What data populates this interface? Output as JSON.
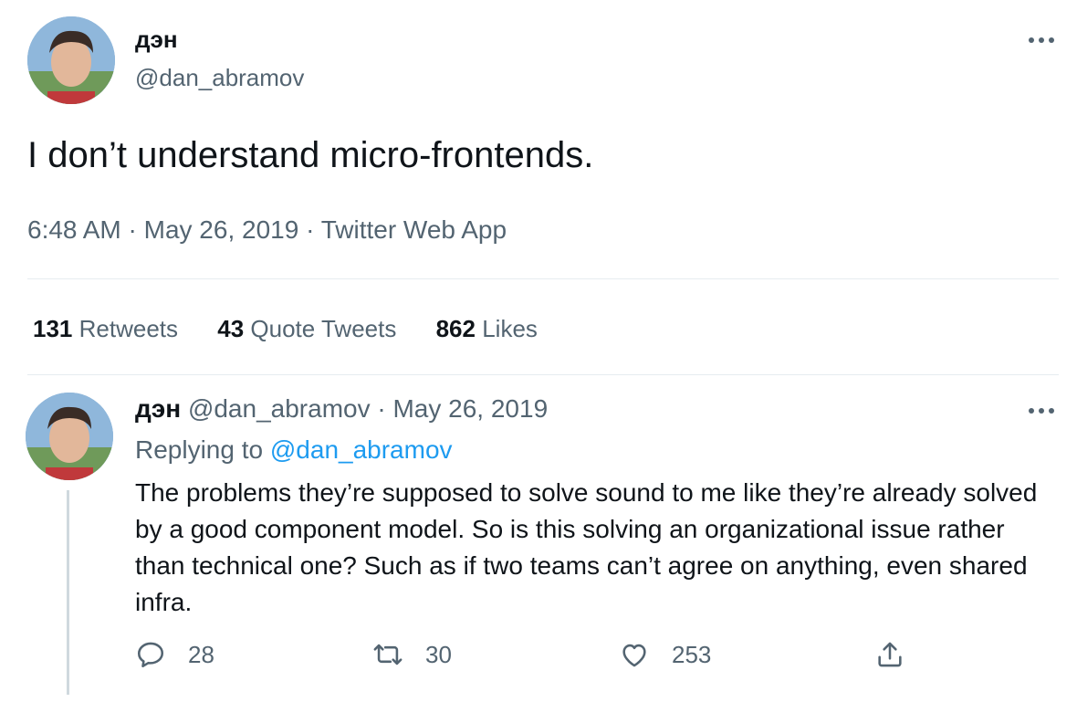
{
  "main_tweet": {
    "author_name": "дэн",
    "author_handle": "@dan_abramov",
    "text": "I don’t understand micro-frontends.",
    "time": "6:48 AM",
    "separator": " · ",
    "date": "May 26, 2019",
    "source": "Twitter Web App",
    "stats": {
      "retweets_count": "131",
      "retweets_label": "Retweets",
      "quotes_count": "43",
      "quotes_label": "Quote Tweets",
      "likes_count": "862",
      "likes_label": "Likes"
    }
  },
  "reply": {
    "author_name": "дэн",
    "author_handle": "@dan_abramov",
    "separator": " · ",
    "date": "May 26, 2019",
    "replying_prefix": "Replying to ",
    "replying_to": "@dan_abramov",
    "text": "The problems they’re supposed to solve sound to me like they’re already solved by a good component model. So is this solving an organizational issue rather than technical one? Such as if two teams can’t agree on anything, even shared infra.",
    "actions": {
      "replies": "28",
      "retweets": "30",
      "likes": "253"
    }
  },
  "icons": {
    "more": "more-dots-icon",
    "reply": "reply-icon",
    "retweet": "retweet-icon",
    "like": "heart-icon",
    "share": "share-icon"
  },
  "colors": {
    "text": "#0f1419",
    "secondary": "#536471",
    "link": "#1d9bf0",
    "divider": "#e6ecf0"
  }
}
